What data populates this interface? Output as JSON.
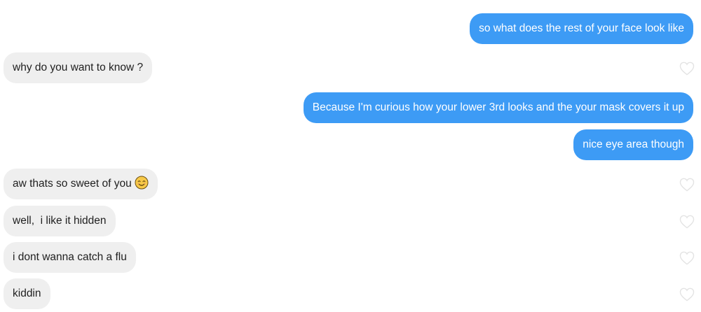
{
  "conversation": {
    "messages": [
      {
        "direction": "sent",
        "text": "so what does the rest of your face look like"
      },
      {
        "direction": "received",
        "text": "why do you want to know ?",
        "like": "heart-outline-icon"
      },
      {
        "direction": "sent",
        "text": "Because I'm curious how your lower 3rd looks and the your mask covers it up"
      },
      {
        "direction": "sent",
        "text": "nice eye area though"
      },
      {
        "direction": "received",
        "text": "aw thats so sweet of you",
        "emoji": "smiling-face-emoji",
        "like": "heart-outline-icon"
      },
      {
        "direction": "received",
        "text": "well,  i like it hidden",
        "like": "heart-outline-icon"
      },
      {
        "direction": "received",
        "text": "i dont wanna catch a flu",
        "like": "heart-outline-icon"
      },
      {
        "direction": "received",
        "text": "kiddin",
        "like": "heart-outline-icon"
      }
    ]
  },
  "colors": {
    "sent_bubble": "#3d9bf5",
    "received_bubble": "#efefef",
    "heart_outline": "#e3e3e3",
    "emoji_face": "#f7c948"
  }
}
